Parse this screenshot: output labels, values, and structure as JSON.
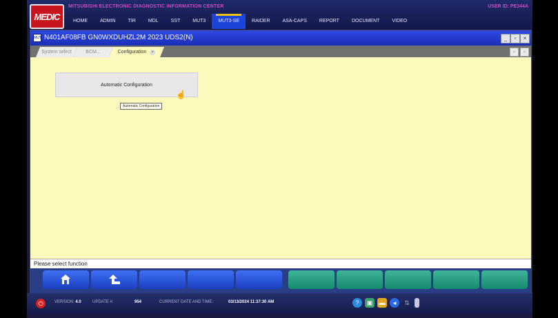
{
  "header": {
    "logo_text": "MEDIC",
    "center_title": "MITSUBISHI ELECTRONIC DIAGNOSTIC INFORMATION CENTER",
    "user_label": "USER ID:",
    "user_id": "PE344A",
    "nav": [
      "HOME",
      "ADMIN",
      "TIR",
      "MDL",
      "SST",
      "MUT3",
      "MUT3-SE",
      "RAIDER",
      "ASA-CAPS",
      "REPORT",
      "DOCUMENT",
      "VIDEO"
    ],
    "active_nav": "MUT3-SE"
  },
  "window": {
    "vehicle_line": "N401AF08FB  GN0WXDUHZL2M 2023   UDS2(N)",
    "minimize": "_",
    "restore": "▫",
    "close": "×"
  },
  "tabs": {
    "items": [
      {
        "label": "System select"
      },
      {
        "label": "BCM..."
      },
      {
        "label": "Configuration",
        "close": "×"
      }
    ],
    "ctrl_1": "«",
    "ctrl_2": "»"
  },
  "main": {
    "auto_button_label": "Automatic Configuration",
    "tooltip": "Automatic Configuration",
    "cursor": "hand-pointer-icon"
  },
  "status": {
    "message": "Please select function"
  },
  "function_keys": {
    "f1_icon": "home-icon",
    "f2_icon": "return-arrow-icon",
    "blue_color": "#2a54dc",
    "green_color": "#1e9c7e"
  },
  "taskbar": {
    "version_label": "VERSION:",
    "version": "4.0",
    "update_label": "UPDATE #:",
    "update": "954",
    "datetime_label": "CURRENT DATE AND TIME:",
    "datetime": "03/13/2024 11:37:30 AM"
  }
}
